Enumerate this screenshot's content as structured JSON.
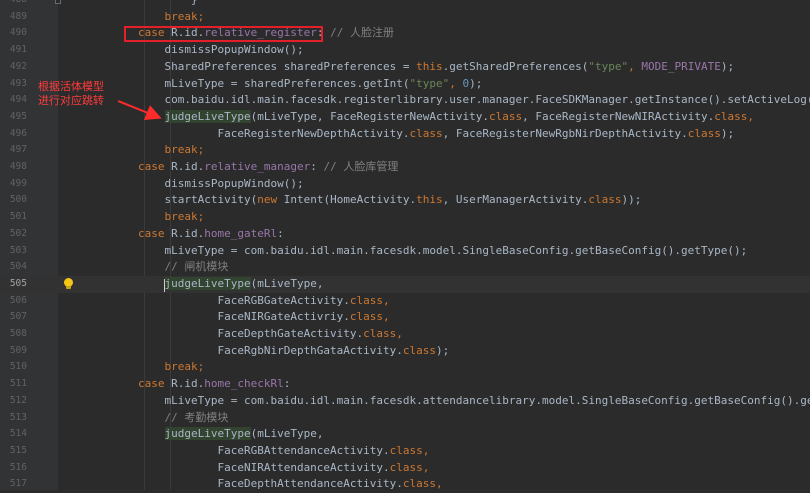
{
  "annotation": {
    "line1": "根据活体模型",
    "line2": "进行对应跳转"
  },
  "lines": [
    {
      "n": "488",
      "tokens": [
        {
          "t": "        }",
          "c": ""
        }
      ]
    },
    {
      "n": "489",
      "tokens": [
        {
          "t": "    ",
          "c": ""
        },
        {
          "t": "break",
          "c": "kw"
        },
        {
          "t": ";",
          "c": "kw"
        }
      ]
    },
    {
      "n": "490",
      "tokens": [
        {
          "t": "case ",
          "c": "kw"
        },
        {
          "t": "R.id.",
          "c": ""
        },
        {
          "t": "relative_register",
          "c": "fld"
        },
        {
          "t": ": ",
          "c": ""
        },
        {
          "t": "// 人脸注册",
          "c": "cmt"
        }
      ]
    },
    {
      "n": "491",
      "tokens": [
        {
          "t": "    dismissPopupWindow();",
          "c": ""
        }
      ]
    },
    {
      "n": "492",
      "tokens": [
        {
          "t": "    SharedPreferences sharedPreferences = ",
          "c": ""
        },
        {
          "t": "this",
          "c": "kw"
        },
        {
          "t": ".getSharedPreferences(",
          "c": ""
        },
        {
          "t": "\"type\"",
          "c": "str"
        },
        {
          "t": ", ",
          "c": "kw"
        },
        {
          "t": "MODE_PRIVATE",
          "c": "fld"
        },
        {
          "t": ");",
          "c": ""
        }
      ]
    },
    {
      "n": "493",
      "tokens": [
        {
          "t": "    mLiveType = sharedPreferences.getInt(",
          "c": ""
        },
        {
          "t": "\"type\"",
          "c": "str"
        },
        {
          "t": ", ",
          "c": "kw"
        },
        {
          "t": "0",
          "c": "num"
        },
        {
          "t": ");",
          "c": ""
        }
      ]
    },
    {
      "n": "494",
      "tokens": [
        {
          "t": "    com.baidu.idl.main.facesdk.registerlibrary.user.manager.FaceSDKManager.",
          "c": ""
        },
        {
          "t": "getInstance",
          "c": ""
        },
        {
          "t": "().setActiveLog();",
          "c": ""
        }
      ]
    },
    {
      "n": "495",
      "tokens": [
        {
          "t": "    ",
          "c": ""
        },
        {
          "t": "judgeLiveType",
          "c": "hl"
        },
        {
          "t": "(mLiveType, FaceRegisterNewActivity.",
          "c": ""
        },
        {
          "t": "class",
          "c": "kw"
        },
        {
          "t": ", FaceRegisterNewNIRActivity.",
          "c": ""
        },
        {
          "t": "class",
          "c": "kw"
        },
        {
          "t": ",",
          "c": "kw"
        }
      ]
    },
    {
      "n": "496",
      "tokens": [
        {
          "t": "            FaceRegisterNewDepthActivity.",
          "c": ""
        },
        {
          "t": "class",
          "c": "kw"
        },
        {
          "t": ", FaceRegisterNewRgbNirDepthActivity.",
          "c": ""
        },
        {
          "t": "class",
          "c": "kw"
        },
        {
          "t": ");",
          "c": ""
        }
      ]
    },
    {
      "n": "497",
      "tokens": [
        {
          "t": "    ",
          "c": ""
        },
        {
          "t": "break",
          "c": "kw"
        },
        {
          "t": ";",
          "c": "kw"
        }
      ]
    },
    {
      "n": "498",
      "tokens": [
        {
          "t": "case ",
          "c": "kw"
        },
        {
          "t": "R.id.",
          "c": ""
        },
        {
          "t": "relative_manager",
          "c": "fld"
        },
        {
          "t": ": ",
          "c": ""
        },
        {
          "t": "// 人脸库管理",
          "c": "cmt"
        }
      ]
    },
    {
      "n": "499",
      "tokens": [
        {
          "t": "    dismissPopupWindow();",
          "c": ""
        }
      ]
    },
    {
      "n": "500",
      "tokens": [
        {
          "t": "    startActivity(",
          "c": ""
        },
        {
          "t": "new ",
          "c": "kw"
        },
        {
          "t": "Intent(HomeActivity.",
          "c": ""
        },
        {
          "t": "this",
          "c": "kw"
        },
        {
          "t": ", UserManagerActivity.",
          "c": ""
        },
        {
          "t": "class",
          "c": "kw"
        },
        {
          "t": "));",
          "c": ""
        }
      ]
    },
    {
      "n": "501",
      "tokens": [
        {
          "t": "    ",
          "c": ""
        },
        {
          "t": "break",
          "c": "kw"
        },
        {
          "t": ";",
          "c": "kw"
        }
      ]
    },
    {
      "n": "502",
      "tokens": [
        {
          "t": "case ",
          "c": "kw"
        },
        {
          "t": "R.id.",
          "c": ""
        },
        {
          "t": "home_gateRl",
          "c": "fld"
        },
        {
          "t": ":",
          "c": ""
        }
      ]
    },
    {
      "n": "503",
      "tokens": [
        {
          "t": "    mLiveType = com.baidu.idl.main.facesdk.model.SingleBaseConfig.",
          "c": ""
        },
        {
          "t": "getBaseConfig",
          "c": ""
        },
        {
          "t": "().getType();",
          "c": ""
        }
      ]
    },
    {
      "n": "504",
      "tokens": [
        {
          "t": "    ",
          "c": ""
        },
        {
          "t": "// 闸机模块",
          "c": "cmt"
        }
      ]
    },
    {
      "n": "505",
      "current": true,
      "tokens": [
        {
          "t": "    ",
          "c": ""
        },
        {
          "t": "judgeLiveType",
          "c": "hl"
        },
        {
          "t": "(mLiveType,",
          "c": ""
        }
      ]
    },
    {
      "n": "506",
      "tokens": [
        {
          "t": "            FaceRGBGateActivity.",
          "c": ""
        },
        {
          "t": "class",
          "c": "kw"
        },
        {
          "t": ",",
          "c": "kw"
        }
      ]
    },
    {
      "n": "507",
      "tokens": [
        {
          "t": "            FaceNIRGateActivriy.",
          "c": ""
        },
        {
          "t": "class",
          "c": "kw"
        },
        {
          "t": ",",
          "c": "kw"
        }
      ]
    },
    {
      "n": "508",
      "tokens": [
        {
          "t": "            FaceDepthGateActivity.",
          "c": ""
        },
        {
          "t": "class",
          "c": "kw"
        },
        {
          "t": ",",
          "c": "kw"
        }
      ]
    },
    {
      "n": "509",
      "tokens": [
        {
          "t": "            FaceRgbNirDepthGataActivity.",
          "c": ""
        },
        {
          "t": "class",
          "c": "kw"
        },
        {
          "t": ");",
          "c": ""
        }
      ]
    },
    {
      "n": "510",
      "tokens": [
        {
          "t": "    ",
          "c": ""
        },
        {
          "t": "break",
          "c": "kw"
        },
        {
          "t": ";",
          "c": "kw"
        }
      ]
    },
    {
      "n": "511",
      "tokens": [
        {
          "t": "case ",
          "c": "kw"
        },
        {
          "t": "R.id.",
          "c": ""
        },
        {
          "t": "home_checkRl",
          "c": "fld"
        },
        {
          "t": ":",
          "c": ""
        }
      ]
    },
    {
      "n": "512",
      "tokens": [
        {
          "t": "    mLiveType = com.baidu.idl.main.facesdk.attendancelibrary.model.SingleBaseConfig.",
          "c": ""
        },
        {
          "t": "getBaseConfig",
          "c": ""
        },
        {
          "t": "().getTy",
          "c": ""
        }
      ]
    },
    {
      "n": "513",
      "tokens": [
        {
          "t": "    ",
          "c": ""
        },
        {
          "t": "// 考勤模块",
          "c": "cmt"
        }
      ]
    },
    {
      "n": "514",
      "tokens": [
        {
          "t": "    ",
          "c": ""
        },
        {
          "t": "judgeLiveType",
          "c": "hl"
        },
        {
          "t": "(mLiveType,",
          "c": ""
        }
      ]
    },
    {
      "n": "515",
      "tokens": [
        {
          "t": "            FaceRGBAttendanceActivity.",
          "c": ""
        },
        {
          "t": "class",
          "c": "kw"
        },
        {
          "t": ",",
          "c": "kw"
        }
      ]
    },
    {
      "n": "516",
      "tokens": [
        {
          "t": "            FaceNIRAttendanceActivity.",
          "c": ""
        },
        {
          "t": "class",
          "c": "kw"
        },
        {
          "t": ",",
          "c": "kw"
        }
      ]
    },
    {
      "n": "517",
      "tokens": [
        {
          "t": "            FaceDepthAttendanceActivity.",
          "c": ""
        },
        {
          "t": "class",
          "c": "kw"
        },
        {
          "t": ",",
          "c": "kw"
        }
      ]
    }
  ]
}
